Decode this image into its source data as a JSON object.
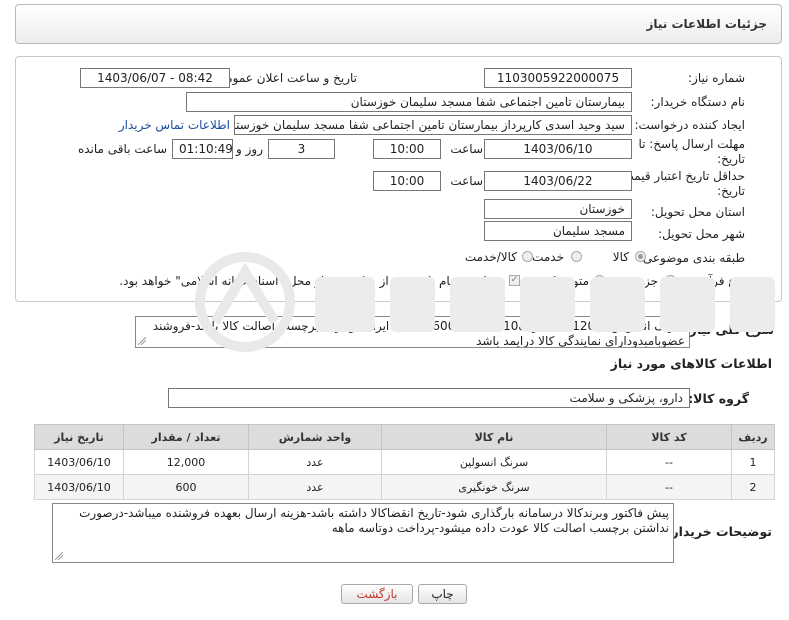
{
  "header": {
    "title": "جزئیات اطلاعات نیاز"
  },
  "form": {
    "need_number_label": "شماره نیاز:",
    "need_number": "1103005922000075",
    "announce_label": "تاریخ و ساعت اعلان عمومی:",
    "announce_value": "1403/06/07 - 08:42",
    "buyer_org_label": "نام دستگاه خریدار:",
    "buyer_org": "بیمارستان تامین اجتماعی شفا مسجد سلیمان خوزستان",
    "requester_label": "ایجاد کننده درخواست:",
    "requester": "سید وحید اسدی کارپرداز بیمارستان تامین اجتماعی شفا مسجد سلیمان خوزستان",
    "contact_link": "اطلاعات تماس خریدار",
    "deadline_label": "مهلت ارسال پاسخ: تا",
    "deadline_label2": "تاریخ:",
    "deadline_date": "1403/06/10",
    "time_label": "ساعت",
    "deadline_time": "10:00",
    "days_value": "3",
    "days_label": "روز و",
    "remaining_value": "01:10:49",
    "remaining_label": "ساعت باقی مانده",
    "validity_label": "حداقل تاریخ اعتبار قیمت: تا",
    "validity_label2": "تاریخ:",
    "validity_date": "1403/06/22",
    "validity_time_label": "ساعت",
    "validity_time": "10:00",
    "province_label": "استان محل تحویل:",
    "province": "خوزستان",
    "city_label": "شهر محل تحویل:",
    "city": "مسجد سلیمان",
    "category_label": "طبقه بندی موضوعی:",
    "category_options": [
      "کالا",
      "خدمت",
      "کالا/خدمت"
    ],
    "process_label": "نوع فرآیند خرید :",
    "process_options": [
      "جزیی",
      "متوسط"
    ],
    "payment_note": "پرداخت تمام یا بخشی از مبلغ خرید،از محل \"اسناد خزانه اسلامی\" خواهد بود."
  },
  "description": {
    "label": "شرح کلی نیاز:",
    "text": "سرنگ انسولین12000عدد-سرنگ10سی سی 600عدد-کالا ایرانی ودارای برچسب اصالت کالا باشد-فروشند عضوبامبدودارای نمایندگی کالا درایمد باشد"
  },
  "items_section": {
    "title": "اطلاعات کالاهای مورد نیاز",
    "group_label": "گروه کالا:",
    "group_value": "دارو، پزشکی و سلامت",
    "columns": [
      "ردیف",
      "کد کالا",
      "نام کالا",
      "واحد شمارش",
      "تعداد / مقدار",
      "تاریخ نیاز"
    ],
    "rows": [
      [
        "1",
        "--",
        "سرنگ انسولین",
        "عدد",
        "12,000",
        "1403/06/10"
      ],
      [
        "2",
        "--",
        "سرنگ خونگیری",
        "عدد",
        "600",
        "1403/06/10"
      ]
    ]
  },
  "buyer_notes": {
    "label": "توضیحات خریدار:",
    "text": "پیش فاکتور وبرندکالا درسامانه بارگذاری شود-تاریخ انقضاکالا داشته باشد-هزینه ارسال بعهده فروشنده میباشد-درصورت نداشتن برچسب اصالت کالا عودت داده میشود-پرداخت دوتاسه ماهه"
  },
  "actions": {
    "print": "چاپ",
    "back": "بازگشت"
  }
}
